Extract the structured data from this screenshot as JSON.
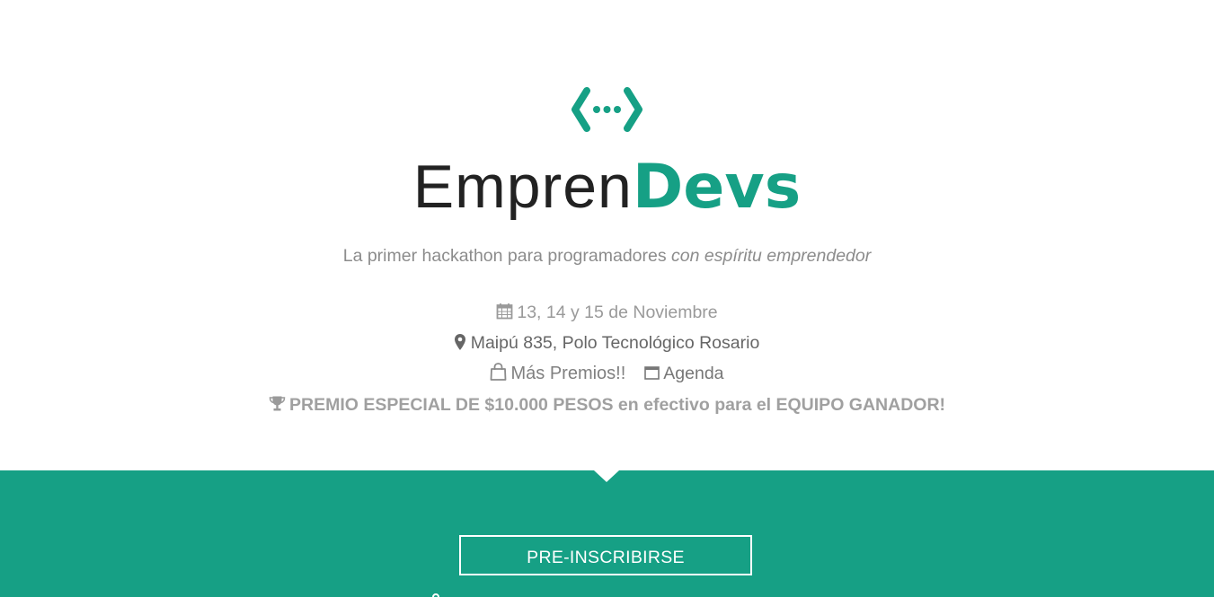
{
  "brand": {
    "name_light": "Empren",
    "name_bold": "Devs",
    "logo_icon": "code-brackets-dots-icon",
    "accent_color": "#16a085"
  },
  "hero": {
    "tagline_plain": "La primer hackathon para programadores ",
    "tagline_emphasis": "con espíritu emprendedor",
    "date": "13, 14 y 15 de Noviembre",
    "date_icon": "calendar-icon",
    "location": "Maipú 835, Polo Tecnológico Rosario",
    "location_icon": "map-marker-icon",
    "prizes_link": "Más Premios!!",
    "prizes_icon": "shopping-bag-icon",
    "agenda_link": "Agenda",
    "agenda_icon": "calendar-outline-icon",
    "special_prize": "PREMIO ESPECIAL DE $10.000 PESOS en efectivo para el EQUIPO GANADOR!",
    "special_prize_icon": "trophy-icon"
  },
  "cta": {
    "preinscribirse_label": "PRE-INSCRIBIRSE",
    "band_color": "#16a085"
  }
}
